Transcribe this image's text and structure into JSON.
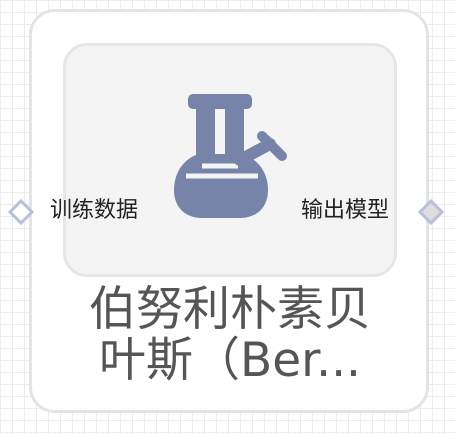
{
  "node": {
    "title_line1": "伯努利朴素贝",
    "title_line2": "叶斯（Ber...",
    "icon": "flask-icon",
    "input_port": {
      "label": "训练数据",
      "icon": "diamond-port-icon"
    },
    "output_port": {
      "label": "输出模型",
      "icon": "diamond-port-icon"
    }
  },
  "colors": {
    "icon_fill": "#7784aa",
    "port_stroke": "#b8bfdc",
    "port_out_fill": "#dddddd",
    "title_text": "#555555"
  }
}
